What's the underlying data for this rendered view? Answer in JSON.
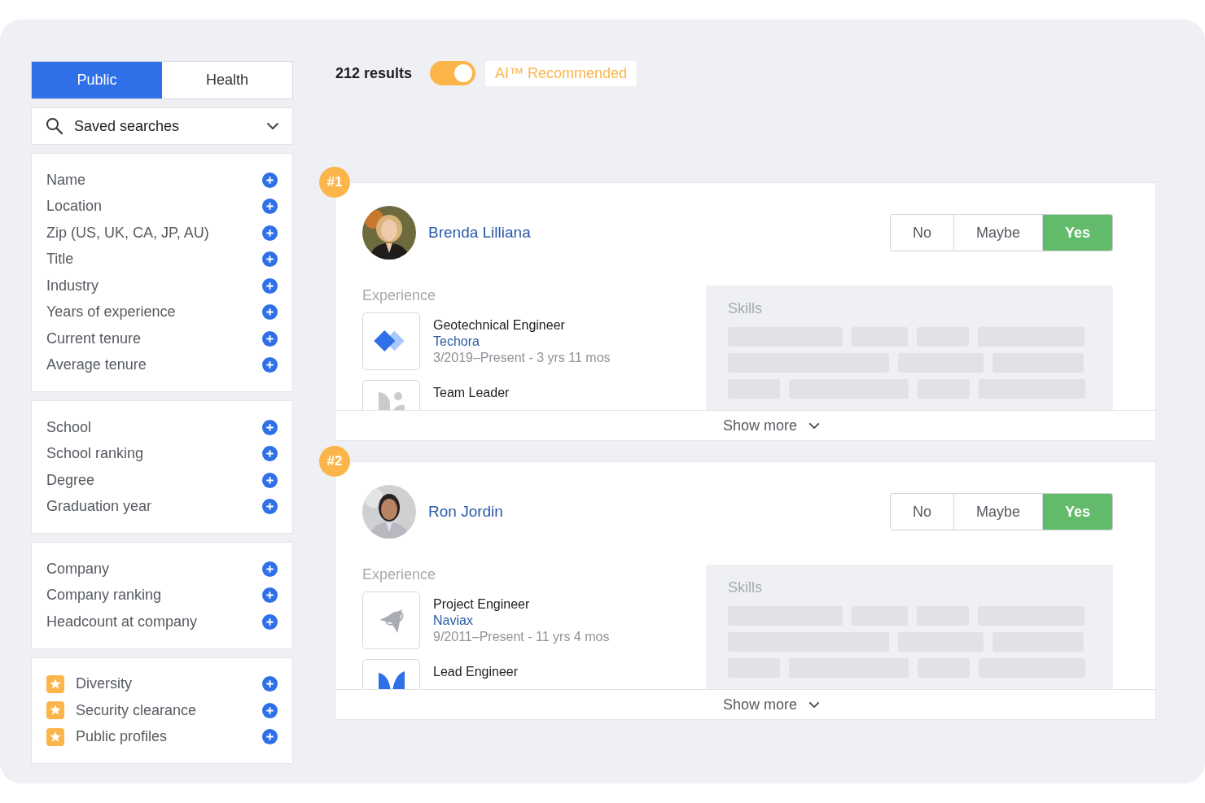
{
  "tabs": [
    {
      "label": "Public",
      "selected": true
    },
    {
      "label": "Health",
      "selected": false
    }
  ],
  "saved_searches": {
    "label": "Saved searches"
  },
  "filter_groups": [
    {
      "items": [
        {
          "label": "Name",
          "premium": false
        },
        {
          "label": "Location",
          "premium": false
        },
        {
          "label": "Zip (US, UK, CA, JP, AU)",
          "premium": false
        },
        {
          "label": "Title",
          "premium": false
        },
        {
          "label": "Industry",
          "premium": false
        },
        {
          "label": "Years of experience",
          "premium": false
        },
        {
          "label": "Current tenure",
          "premium": false
        },
        {
          "label": "Average tenure",
          "premium": false
        }
      ]
    },
    {
      "items": [
        {
          "label": "School",
          "premium": false
        },
        {
          "label": "School ranking",
          "premium": false
        },
        {
          "label": "Degree",
          "premium": false
        },
        {
          "label": "Graduation year",
          "premium": false
        }
      ]
    },
    {
      "items": [
        {
          "label": "Company",
          "premium": false
        },
        {
          "label": "Company ranking",
          "premium": false
        },
        {
          "label": "Headcount at company",
          "premium": false
        }
      ]
    },
    {
      "items": [
        {
          "label": "Diversity",
          "premium": true
        },
        {
          "label": "Security clearance",
          "premium": true
        },
        {
          "label": "Public profiles",
          "premium": true
        }
      ]
    }
  ],
  "results": {
    "count": "212 results",
    "ai_toggle": {
      "on": true
    },
    "ai_label": "AI™ Recommended"
  },
  "candidates": [
    {
      "rank": "#1",
      "name": "Brenda Lilliana",
      "decisions": [
        {
          "label": "No",
          "selected": false
        },
        {
          "label": "Maybe",
          "selected": false
        },
        {
          "label": "Yes",
          "selected": true
        }
      ],
      "experience_label": "Experience",
      "experience": [
        {
          "title": "Geotechnical Engineer",
          "company": "Techora",
          "dates": "3/2019–Present - 3 yrs 11 mos",
          "kind": "diamonds"
        },
        {
          "title": "Team Leader",
          "kind": "figure"
        }
      ],
      "skills_label": "Skills",
      "show_more": "Show more"
    },
    {
      "rank": "#2",
      "name": "Ron Jordin",
      "decisions": [
        {
          "label": "No",
          "selected": false
        },
        {
          "label": "Maybe",
          "selected": false
        },
        {
          "label": "Yes",
          "selected": true
        }
      ],
      "experience_label": "Experience",
      "experience": [
        {
          "title": "Project Engineer",
          "company": "Naviax",
          "dates": "9/2011–Present - 11 yrs 4 mos",
          "kind": "plane"
        },
        {
          "title": "Lead Engineer",
          "kind": "leaves"
        }
      ],
      "skills_label": "Skills",
      "show_more": "Show more"
    }
  ]
}
